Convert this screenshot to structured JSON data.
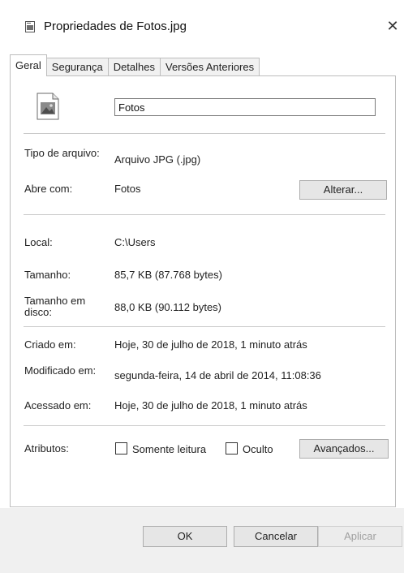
{
  "window": {
    "title": "Propriedades de Fotos.jpg",
    "close_symbol": "✕",
    "title_icon": "file-properties-icon"
  },
  "tabs": [
    {
      "label": "Geral",
      "active": true
    },
    {
      "label": "Segurança",
      "active": false
    },
    {
      "label": "Detalhes",
      "active": false
    },
    {
      "label": "Versões Anteriores",
      "active": false
    }
  ],
  "general": {
    "file_icon": "image-file-icon",
    "name_value": "Fotos",
    "file_type_label": "Tipo de arquivo:",
    "file_type_value": "Arquivo JPG (.jpg)",
    "opens_with_label": "Abre com:",
    "opens_with_value": "Fotos",
    "change_button": "Alterar...",
    "location_label": "Local:",
    "location_value": "C:\\Users",
    "size_label": "Tamanho:",
    "size_value": "85,7 KB (87.768 bytes)",
    "size_on_disk_label": "Tamanho em disco:",
    "size_on_disk_value": "88,0 KB (90.112 bytes)",
    "created_label": "Criado em:",
    "created_value": "Hoje, 30 de julho de 2018, 1 minuto atrás",
    "modified_label": "Modificado em:",
    "modified_value": "segunda-feira, 14 de abril de 2014, 11:08:36",
    "accessed_label": "Acessado em:",
    "accessed_value": "Hoje, 30 de julho de 2018, 1 minuto atrás",
    "attributes_label": "Atributos:",
    "readonly_label": "Somente leitura",
    "readonly_checked": false,
    "hidden_label": "Oculto",
    "hidden_checked": false,
    "advanced_button": "Avançados..."
  },
  "footer": {
    "ok_button": "OK",
    "cancel_button": "Cancelar",
    "apply_button": "Aplicar",
    "apply_enabled": false
  }
}
